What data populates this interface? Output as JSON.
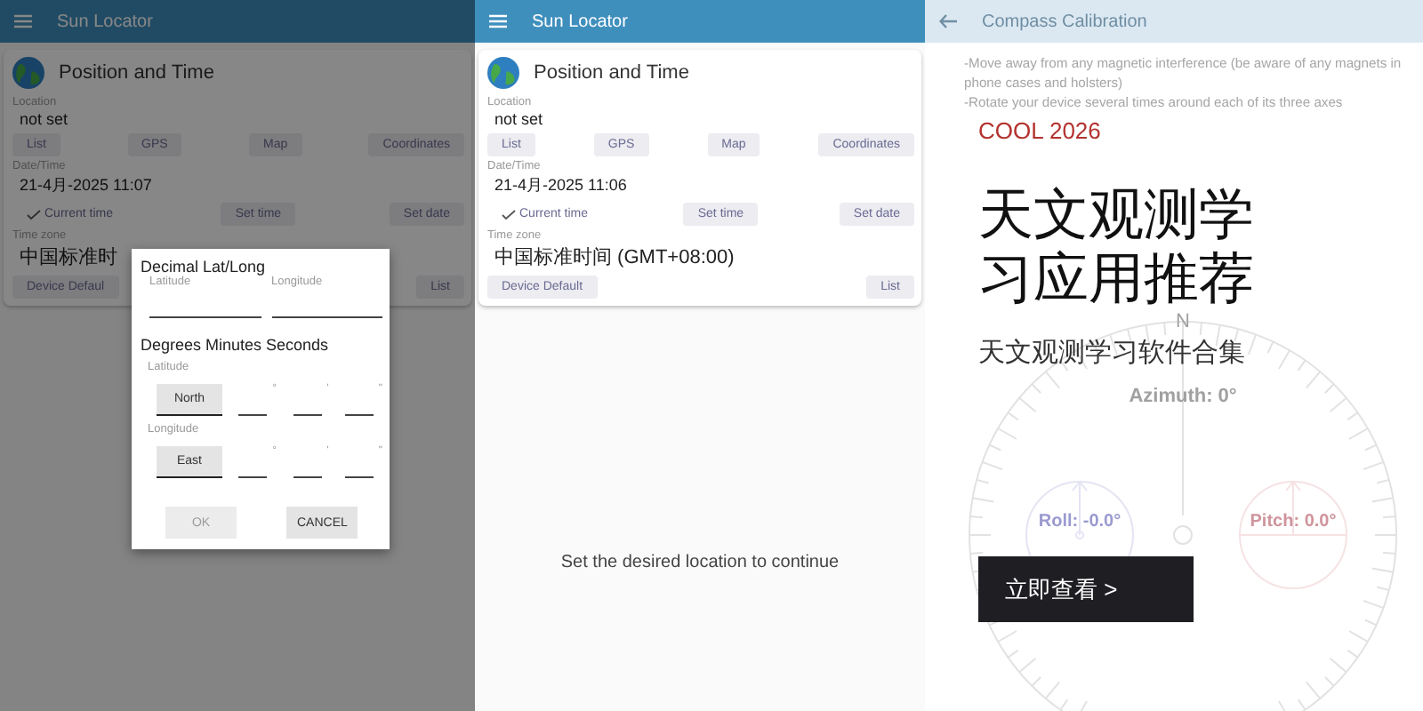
{
  "panels": [
    {
      "app_bar": {
        "title": "Sun Locator"
      },
      "card": {
        "title": "Position and Time",
        "sections": [
          {
            "label": "Location",
            "value": "not set",
            "buttons": [
              {
                "label": "List",
                "checked": false
              },
              {
                "label": "GPS",
                "checked": false
              },
              {
                "label": "Map",
                "checked": false
              },
              {
                "label": "Coordinates",
                "checked": false
              }
            ]
          },
          {
            "label": "Date/Time",
            "value": "21-4月-2025 11:07",
            "buttons": [
              {
                "label": "Current time",
                "checked": true
              },
              {
                "label": "Set time",
                "checked": false
              },
              {
                "label": "Set date",
                "checked": false
              }
            ]
          },
          {
            "label": "Time zone",
            "value": "中国标准时",
            "buttons": [
              {
                "label": "Device Defaul",
                "checked": false
              },
              {
                "label": "List",
                "checked": false
              }
            ]
          }
        ]
      },
      "dialog": {
        "decimal_title": "Decimal Lat/Long",
        "decimal_fields": [
          {
            "label": "Latitude"
          },
          {
            "label": "Longitude"
          }
        ],
        "dms_title": "Degrees Minutes Seconds",
        "dms_rows": [
          {
            "label": "Latitude",
            "hemisphere": "North",
            "units": [
              "°",
              "'",
              "\""
            ]
          },
          {
            "label": "Longitude",
            "hemisphere": "East",
            "units": [
              "°",
              "'",
              "\""
            ]
          }
        ],
        "buttons": [
          {
            "label": "OK",
            "disabled": true
          },
          {
            "label": "CANCEL",
            "disabled": false
          }
        ]
      }
    },
    {
      "app_bar": {
        "title": "Sun Locator"
      },
      "card": {
        "title": "Position and Time",
        "sections": [
          {
            "label": "Location",
            "value": "not set",
            "buttons": [
              {
                "label": "List",
                "checked": false
              },
              {
                "label": "GPS",
                "checked": false
              },
              {
                "label": "Map",
                "checked": false
              },
              {
                "label": "Coordinates",
                "checked": false
              }
            ]
          },
          {
            "label": "Date/Time",
            "value": "21-4月-2025 11:06",
            "buttons": [
              {
                "label": "Current time",
                "checked": true
              },
              {
                "label": "Set time",
                "checked": false
              },
              {
                "label": "Set date",
                "checked": false
              }
            ]
          },
          {
            "label": "Time zone",
            "value": "中国标准时间 (GMT+08:00)",
            "buttons": [
              {
                "label": "Device Default",
                "checked": false
              },
              {
                "label": "List",
                "checked": false
              }
            ]
          }
        ]
      },
      "message": "Set the desired location to continue"
    }
  ],
  "calibration": {
    "title": "Compass Calibration",
    "instructions": [
      "-Move away from any magnetic interference (be aware of any magnets in phone cases and holsters)",
      "-Rotate your device several times around each of its three axes"
    ],
    "compass": {
      "north": "N",
      "azimuth": "Azimuth: 0°",
      "roll": "Roll: -0.0°",
      "pitch": "Pitch: 0.0°"
    }
  },
  "promo": {
    "tag": "COOL 2026",
    "headline": [
      "天文观测学",
      "习应用推荐"
    ],
    "subtitle": "天文观测学习软件合集",
    "button": "立即查看 >"
  }
}
